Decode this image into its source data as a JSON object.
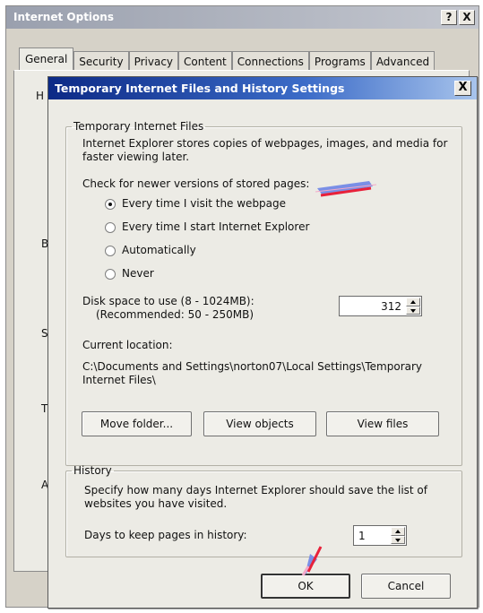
{
  "outer_window": {
    "title": "Internet Options",
    "help_button": "?",
    "close_button": "X",
    "tabs": [
      "General",
      "Security",
      "Privacy",
      "Content",
      "Connections",
      "Programs",
      "Advanced"
    ],
    "side_letters": [
      "H",
      "B",
      "S",
      "T",
      "A"
    ]
  },
  "dialog": {
    "title": "Temporary Internet Files and History Settings",
    "close_button": "X",
    "tif_group": {
      "legend": "Temporary Internet Files",
      "description": "Internet Explorer stores copies of webpages, images, and media for faster viewing later.",
      "check_label": "Check for newer versions of stored pages:",
      "options": [
        {
          "label": "Every time I visit the webpage",
          "checked": true
        },
        {
          "label": "Every time I start Internet Explorer",
          "checked": false
        },
        {
          "label": "Automatically",
          "checked": false
        },
        {
          "label": "Never",
          "checked": false
        }
      ],
      "disk_space_label": "Disk space to use (8 - 1024MB):",
      "disk_space_recommended": "(Recommended: 50 - 250MB)",
      "disk_space_value": "312",
      "current_location_label": "Current location:",
      "current_location_path": "C:\\Documents and Settings\\norton07\\Local Settings\\Temporary Internet Files\\",
      "buttons": {
        "move_folder": "Move folder...",
        "view_objects": "View objects",
        "view_files": "View files"
      }
    },
    "history_group": {
      "legend": "History",
      "description": "Specify how many days Internet Explorer should save the list of websites you have visited.",
      "days_label": "Days to keep pages in history:",
      "days_value": "1"
    },
    "ok_button": "OK",
    "cancel_button": "Cancel"
  },
  "annotations": {
    "arrow_color": "#e8213a",
    "arrow_fill": "#7a8fe6"
  }
}
